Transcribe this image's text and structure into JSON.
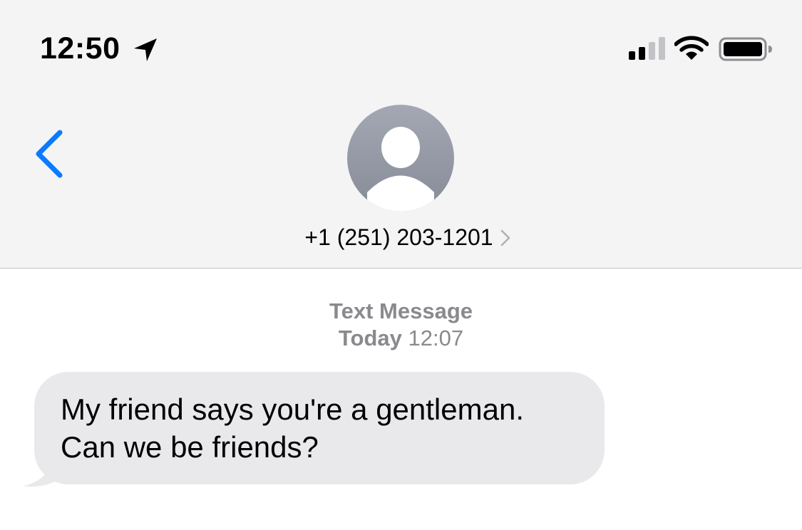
{
  "status_bar": {
    "time": "12:50",
    "icons": [
      "location-arrow-icon",
      "cellular-signal-icon",
      "wifi-icon",
      "battery-icon"
    ]
  },
  "nav": {
    "back_icon": "chevron-left-icon",
    "contact": {
      "avatar_icon": "person-silhouette-icon",
      "name": "+1 (251) 203-1201",
      "chevron_icon": "chevron-right-icon"
    }
  },
  "conversation": {
    "service_label": "Text Message",
    "timestamp_day": "Today",
    "timestamp_time": "12:07",
    "messages": [
      {
        "direction": "incoming",
        "text": "My friend says you're a gentleman.\nCan we be friends?"
      }
    ]
  },
  "colors": {
    "accent": "#0a7aff",
    "header_bg": "#f4f4f4",
    "incoming_bubble": "#e9e9eb",
    "meta_text": "#8a8a8e",
    "avatar_gray": "#9a9fa9"
  }
}
